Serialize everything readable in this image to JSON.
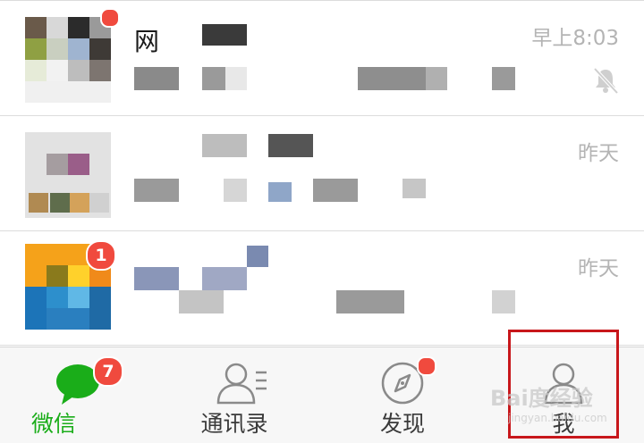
{
  "chats": [
    {
      "title_fragment": "网",
      "time": "早上8:03",
      "muted": true,
      "badge": ""
    },
    {
      "title_fragment": "",
      "time": "昨天",
      "muted": false,
      "badge": ""
    },
    {
      "title_fragment": "",
      "time": "昨天",
      "muted": false,
      "badge": "1"
    }
  ],
  "tabbar": {
    "tabs": [
      {
        "label": "微信",
        "badge": "7",
        "active": true,
        "icon": "chat-bubble-icon"
      },
      {
        "label": "通讯录",
        "badge": "",
        "active": false,
        "icon": "contacts-icon"
      },
      {
        "label": "发现",
        "badge": "dot",
        "active": false,
        "icon": "compass-icon"
      },
      {
        "label": "我",
        "badge": "",
        "active": false,
        "icon": "person-icon"
      }
    ]
  },
  "watermark": {
    "text": "Bai度经验",
    "sub": "jingyan.baidu.com"
  },
  "colors": {
    "accent": "#1aad19",
    "badge": "#f04a3e",
    "highlight": "#c8171b"
  }
}
